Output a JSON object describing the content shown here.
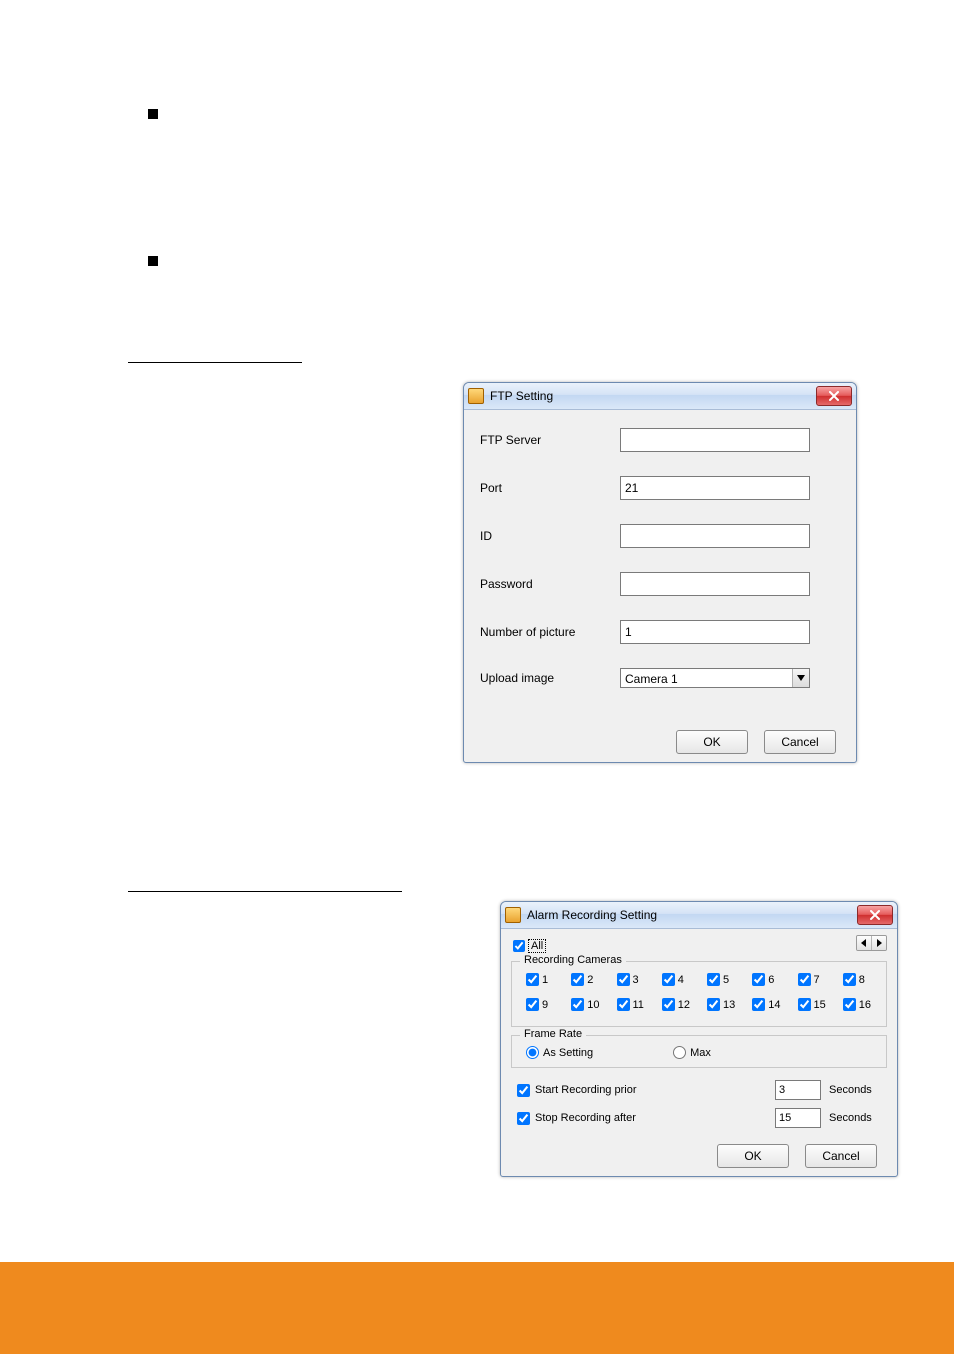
{
  "bullets": {
    "b1": "",
    "b2": ""
  },
  "ftp": {
    "title": "FTP Setting",
    "labels": {
      "server": "FTP Server",
      "port": "Port",
      "id": "ID",
      "password": "Password",
      "numpic": "Number of picture",
      "upload": "Upload image"
    },
    "values": {
      "server": "",
      "port": "21",
      "id": "",
      "password": "",
      "numpic": "1",
      "upload_selected": "Camera 1"
    },
    "buttons": {
      "ok": "OK",
      "cancel": "Cancel"
    }
  },
  "alarm": {
    "title": "Alarm Recording Setting",
    "all_label": "All",
    "all_checked": true,
    "recording_legend": "Recording Cameras",
    "camera_labels": [
      "1",
      "2",
      "3",
      "4",
      "5",
      "6",
      "7",
      "8",
      "9",
      "10",
      "11",
      "12",
      "13",
      "14",
      "15",
      "16"
    ],
    "framerate_legend": "Frame Rate",
    "framerate_options": {
      "assetting": "As Setting",
      "max": "Max"
    },
    "framerate_selected": "assetting",
    "start_label": "Start Recording prior",
    "start_checked": true,
    "start_value": "3",
    "stop_label": "Stop Recording after",
    "stop_checked": true,
    "stop_value": "15",
    "seconds_label": "Seconds",
    "buttons": {
      "ok": "OK",
      "cancel": "Cancel"
    }
  }
}
